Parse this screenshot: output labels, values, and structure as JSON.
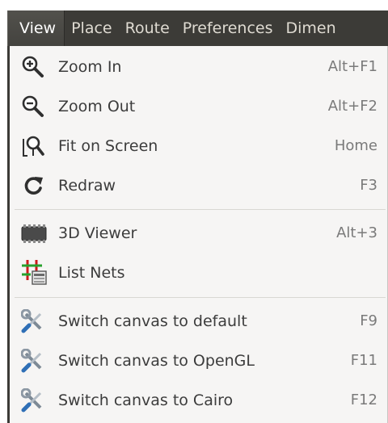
{
  "menubar": {
    "items": [
      "View",
      "Place",
      "Route",
      "Preferences",
      "Dimen"
    ]
  },
  "dropdown": {
    "items": [
      {
        "label": "Zoom In",
        "accel": "Alt+F1",
        "icon": "zoom-in-icon"
      },
      {
        "label": "Zoom Out",
        "accel": "Alt+F2",
        "icon": "zoom-out-icon"
      },
      {
        "label": "Fit on Screen",
        "accel": "Home",
        "icon": "zoom-fit-icon"
      },
      {
        "label": "Redraw",
        "accel": "F3",
        "icon": "redraw-icon"
      },
      {
        "label": "3D Viewer",
        "accel": "Alt+3",
        "icon": "3d-viewer-icon"
      },
      {
        "label": "List Nets",
        "accel": "",
        "icon": "list-nets-icon"
      },
      {
        "label": "Switch canvas to default",
        "accel": "F9",
        "icon": "tools-icon"
      },
      {
        "label": "Switch canvas to OpenGL",
        "accel": "F11",
        "icon": "tools-icon"
      },
      {
        "label": "Switch canvas to Cairo",
        "accel": "F12",
        "icon": "tools-icon"
      }
    ]
  },
  "colors": {
    "menubar_bg": "#3c3b37",
    "dropdown_bg": "#f6f5f4",
    "label_text": "#3c3c3c",
    "accel_text": "#7a7a7a"
  }
}
